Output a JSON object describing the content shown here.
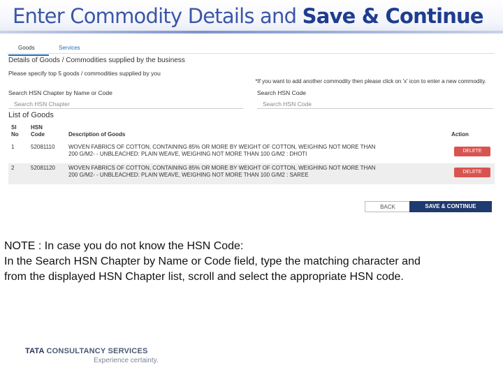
{
  "slide": {
    "title_plain": "Enter Commodity Details and ",
    "title_bold": "Save & Continue"
  },
  "screenshot": {
    "tabs": [
      "Goods",
      "Services"
    ],
    "section_title": "Details of Goods / Commodities supplied by the business",
    "instruction": "Please specify top 5 goods / commodities supplied by you",
    "hint": "*If you want to add another commodity then please click on 'x' icon to enter a new commodity.",
    "search_chapter_label": "Search HSN Chapter by Name or Code",
    "search_chapter_placeholder": "Search HSN Chapter",
    "search_code_label": "Search HSN Code",
    "search_code_placeholder": "Search HSN Code",
    "list_title": "List of Goods",
    "columns": {
      "sl_no_1": "Sl",
      "sl_no_2": "No",
      "hsn_1": "HSN",
      "hsn_2": "Code",
      "description": "Description of Goods",
      "action": "Action"
    },
    "rows": [
      {
        "sl": "1",
        "code": "52081110",
        "desc_line1": "WOVEN FABRICS OF COTTON, CONTAINING 85% OR MORE BY WEIGHT OF COTTON, WEIGHING NOT MORE THAN",
        "desc_line2": "200 G/M2- - UNBLEACHED: PLAIN WEAVE, WEIGHING NOT MORE THAN 100 G/M2 : DHOTI",
        "action": "DELETE"
      },
      {
        "sl": "2",
        "code": "52081120",
        "desc_line1": "WOVEN FABRICS OF COTTON, CONTAINING 85% OR MORE BY WEIGHT OF COTTON, WEIGHING NOT MORE THAN",
        "desc_line2": "200 G/M2- - UNBLEACHED: PLAIN WEAVE, WEIGHING NOT MORE THAN 100 G/M2 : SAREE",
        "action": "DELETE"
      }
    ],
    "back_label": "BACK",
    "save_label": "SAVE & CONTINUE"
  },
  "note": {
    "line1": "NOTE : In case you do not know the HSN Code:",
    "line2": "In the Search HSN Chapter by Name or Code field, type the matching character and",
    "line3": "from the displayed HSN Chapter list, scroll and select the appropriate HSN code."
  },
  "footer": {
    "brand_tata": "TATA",
    "brand_rest": " CONSULTANCY SERVICES",
    "tagline": "Experience certainty."
  },
  "colors": {
    "title_blue": "#3a57a8",
    "save_button": "#1f3a6e",
    "delete_button": "#d9534f",
    "tab_active": "#1f6fb5"
  }
}
